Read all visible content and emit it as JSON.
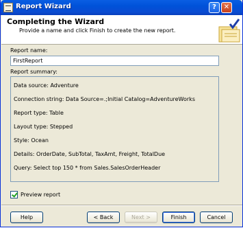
{
  "window": {
    "title": "Report Wizard",
    "help_glyph": "?",
    "close_glyph": "✕"
  },
  "header": {
    "title": "Completing the Wizard",
    "subtitle": "Provide a name and click Finish to create the new report."
  },
  "form": {
    "name_label": "Report name:",
    "name_value": "FirstReport",
    "summary_label": "Report summary:",
    "summary_lines": [
      "Data source: Adventure",
      "Connection string: Data Source=.;Initial Catalog=AdventureWorks",
      "Report type: Table",
      "Layout type: Stepped",
      "Style: Ocean",
      "Details: OrderDate, SubTotal, TaxAmt, Freight, TotalDue",
      "Query:  Select top 150 * from Sales.SalesOrderHeader"
    ],
    "preview_label": "Preview report",
    "preview_checked": true
  },
  "buttons": {
    "help": "Help",
    "back": "< Back",
    "next": "Next >",
    "finish": "Finish",
    "cancel": "Cancel"
  },
  "icons": {
    "app": "report-wizard-icon",
    "header": "wizard-check-icon"
  }
}
